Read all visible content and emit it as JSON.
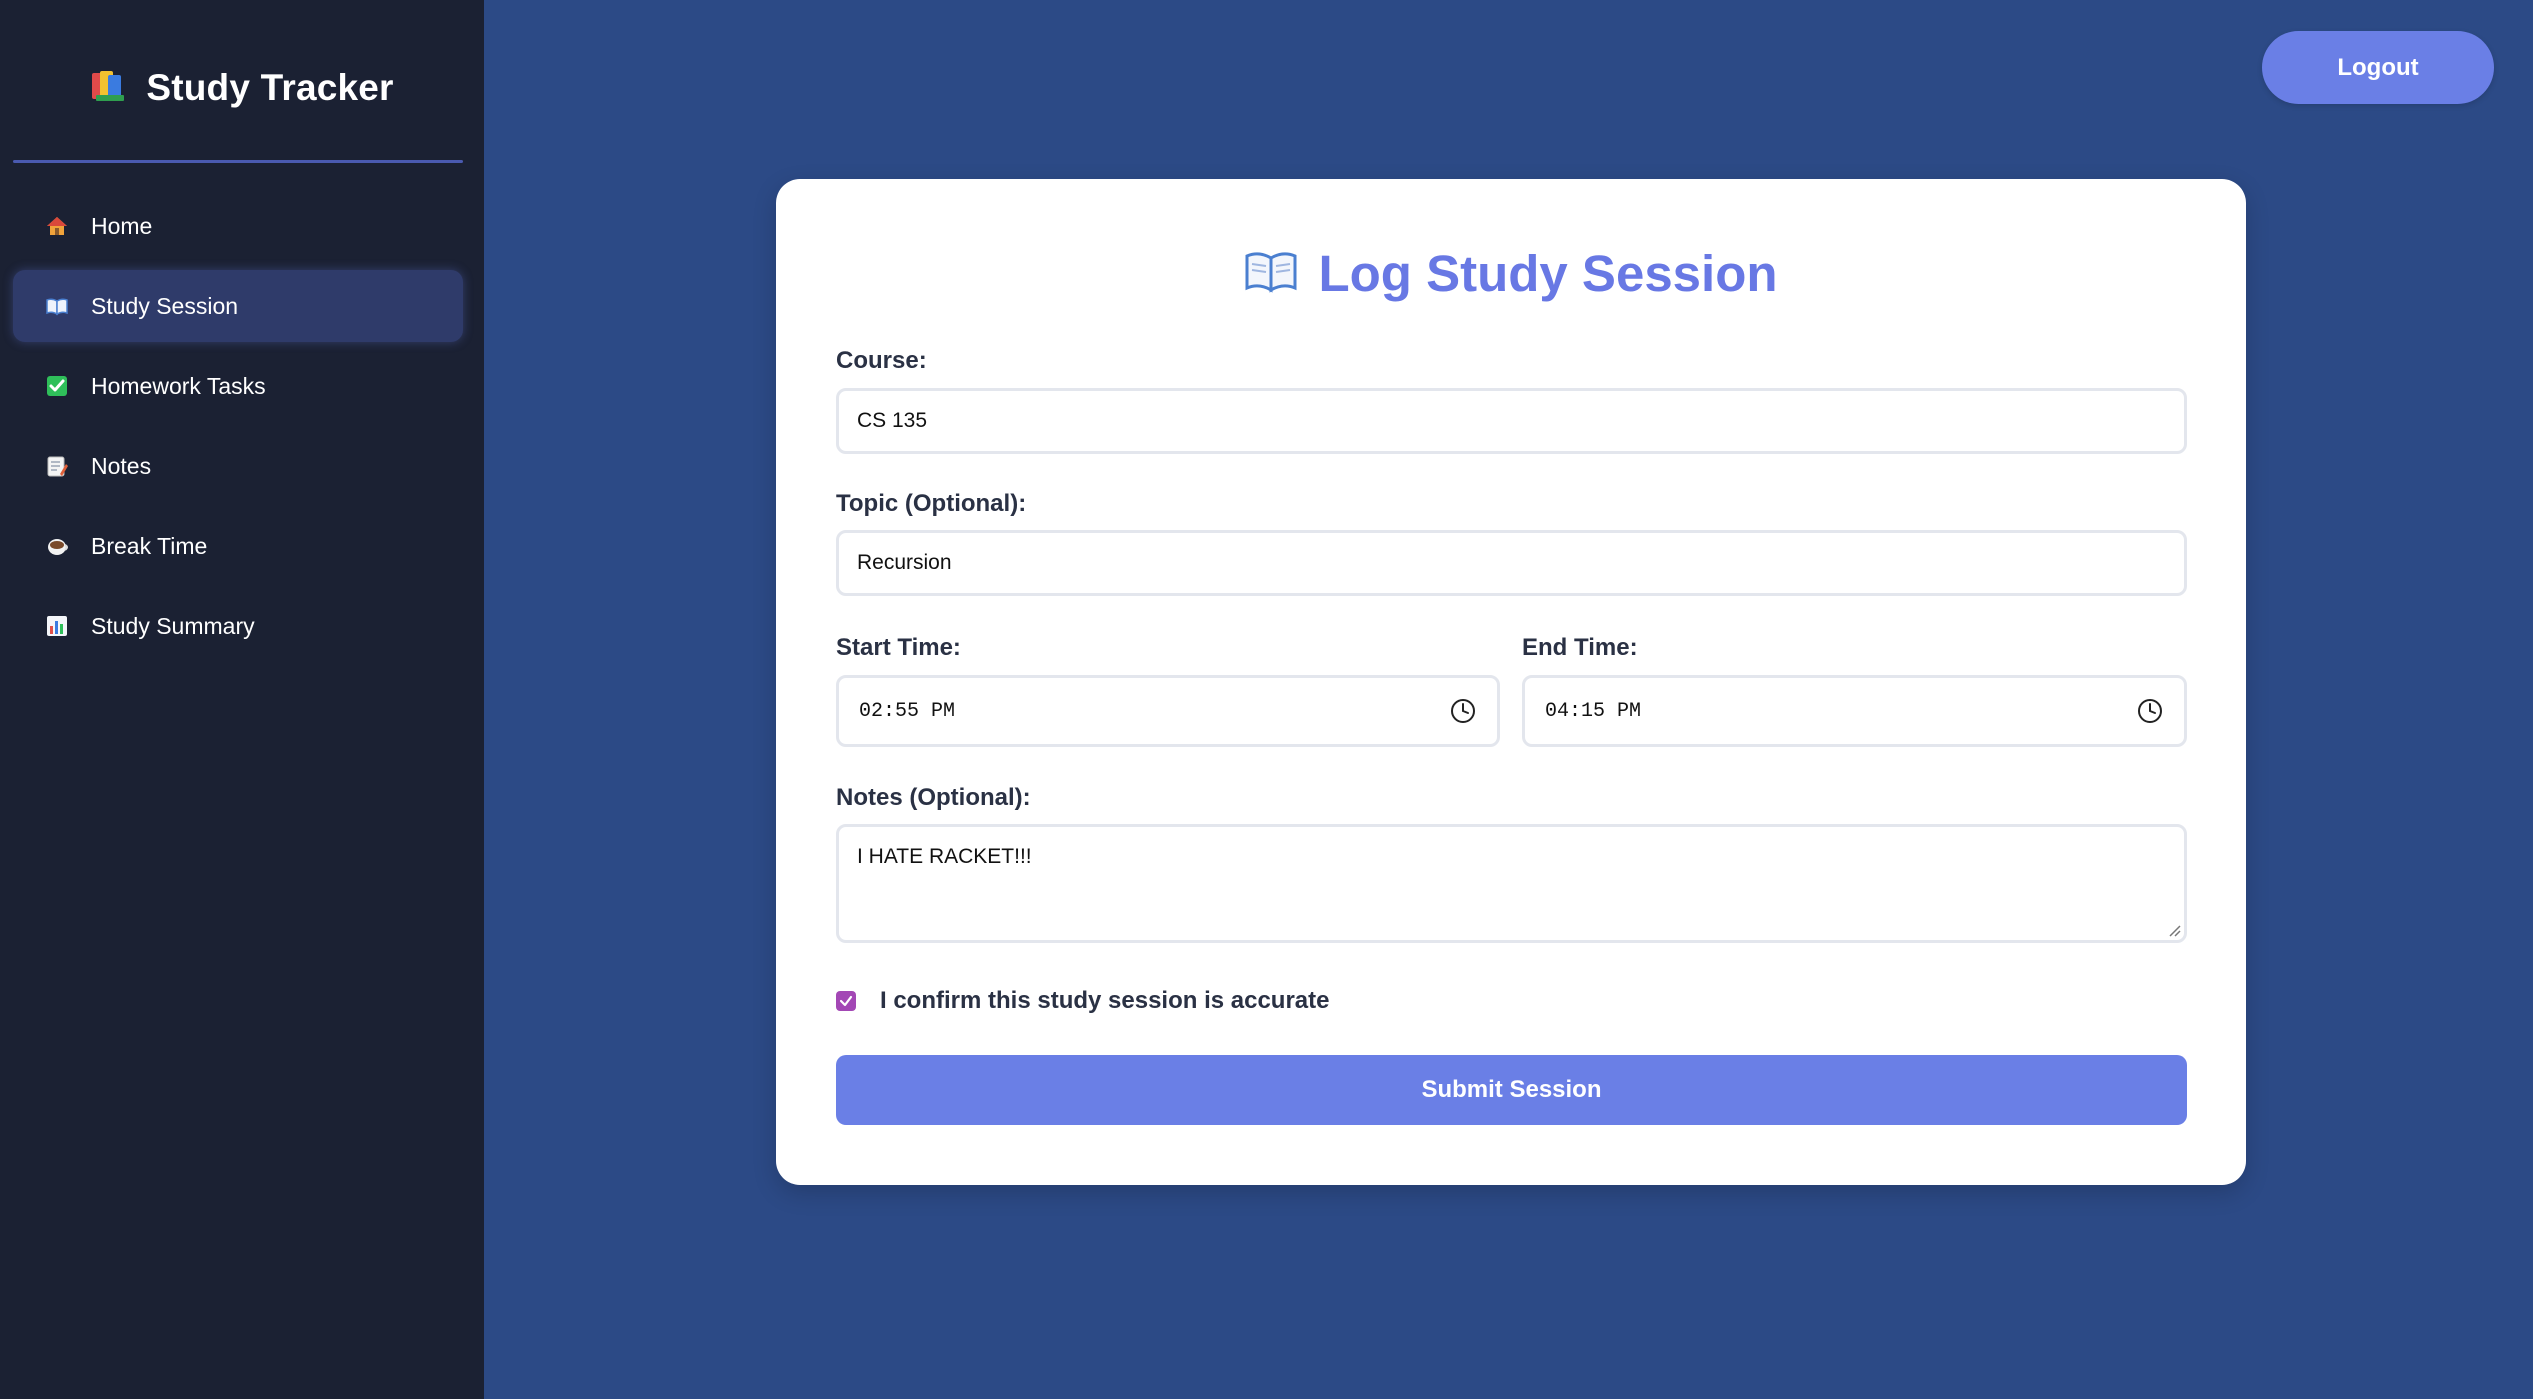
{
  "sidebar": {
    "brand": {
      "icon": "books-icon",
      "title": "Study Tracker"
    },
    "items": [
      {
        "label": "Home",
        "icon": "house-icon",
        "active": false
      },
      {
        "label": "Study Session",
        "icon": "open-book-icon",
        "active": true
      },
      {
        "label": "Homework Tasks",
        "icon": "check-box-icon",
        "active": false
      },
      {
        "label": "Notes",
        "icon": "memo-icon",
        "active": false
      },
      {
        "label": "Break Time",
        "icon": "coffee-icon",
        "active": false
      },
      {
        "label": "Study Summary",
        "icon": "bar-chart-icon",
        "active": false
      }
    ]
  },
  "header": {
    "logout_label": "Logout"
  },
  "form": {
    "title": "Log Study Session",
    "title_icon": "open-book-icon",
    "course": {
      "label": "Course:",
      "value": "CS 135"
    },
    "topic": {
      "label": "Topic (Optional):",
      "value": "Recursion"
    },
    "start_time": {
      "label": "Start Time:",
      "value": "02:55 PM"
    },
    "end_time": {
      "label": "End Time:",
      "value": "04:15 PM"
    },
    "notes": {
      "label": "Notes (Optional):",
      "value": "I HATE RACKET!!!"
    },
    "confirm": {
      "label": "I confirm this study session is accurate",
      "checked": true
    },
    "submit_label": "Submit Session"
  },
  "colors": {
    "page_bg": "#2c4a86",
    "sidebar_bg": "#1b2133",
    "accent": "#6a7fe6",
    "title": "#6878e4",
    "checkbox": "#a347b5"
  }
}
